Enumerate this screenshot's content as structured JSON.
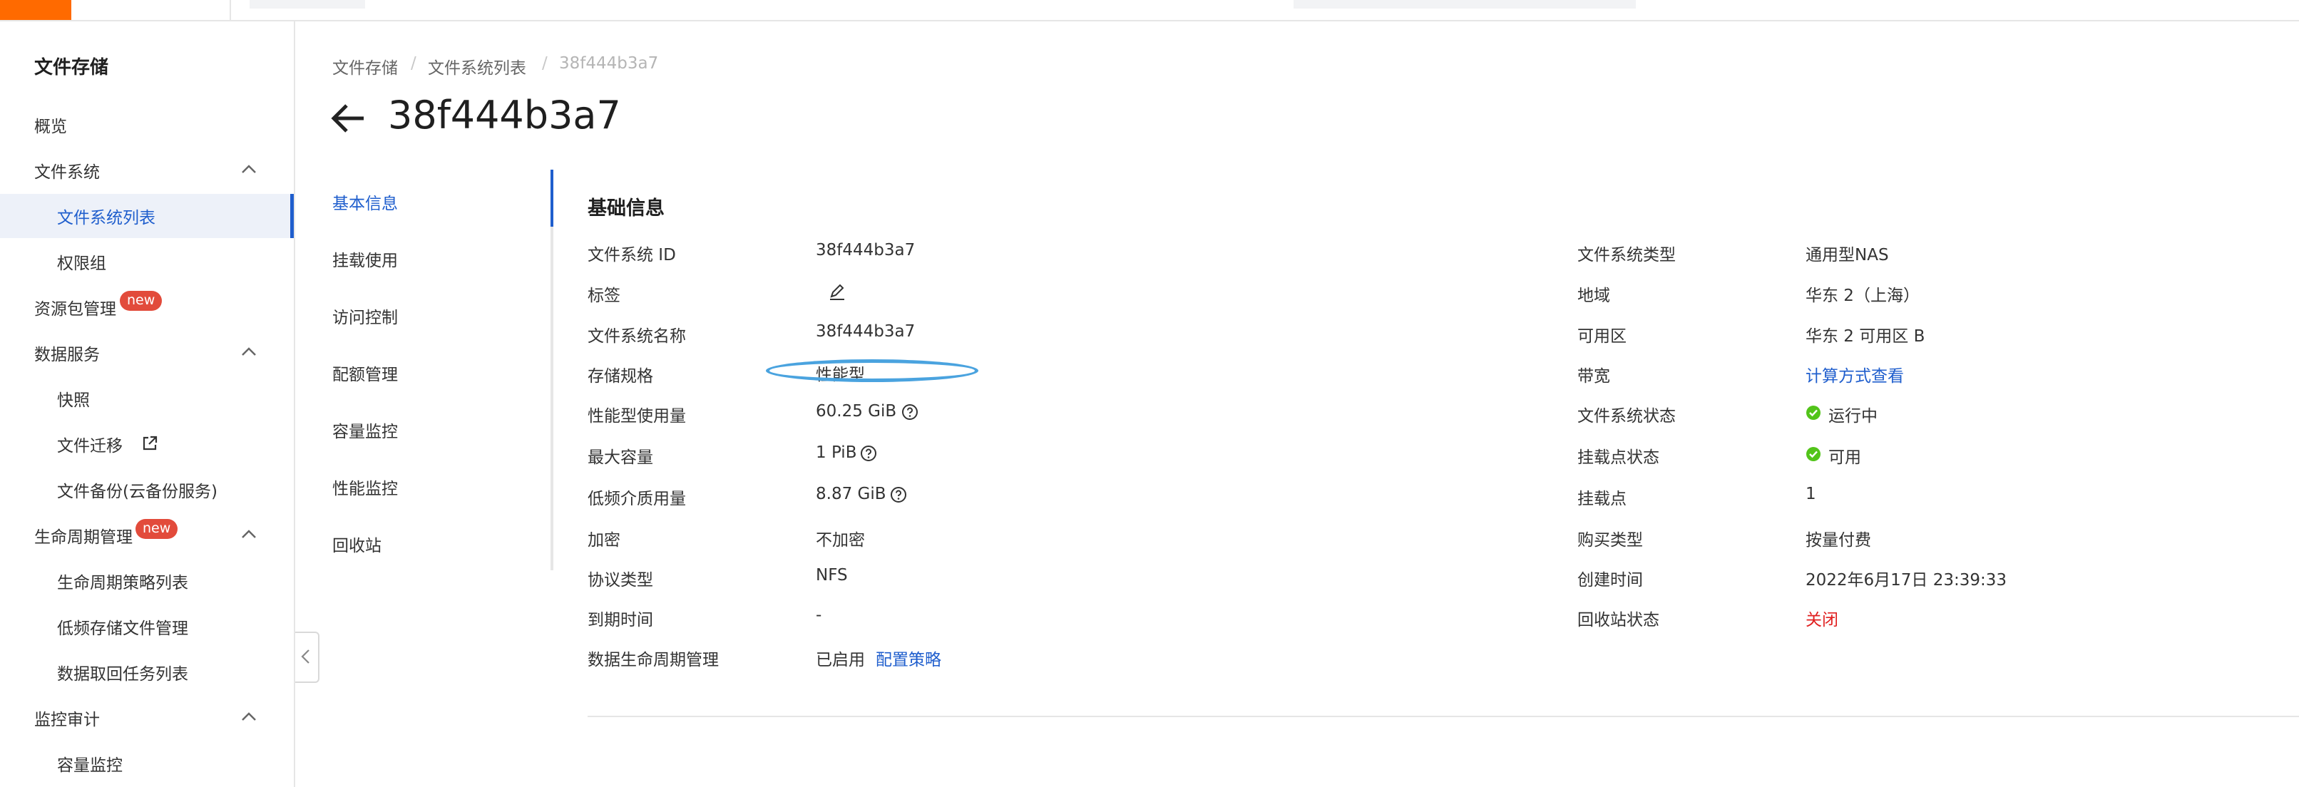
{
  "sidebar": {
    "title": "文件存储",
    "items": {
      "overview": "概览",
      "fs": "文件系统",
      "fs_list": "文件系统列表",
      "perm_group": "权限组",
      "pkg_mgmt": "资源包管理",
      "data_service": "数据服务",
      "snapshot": "快照",
      "migrate": "文件迁移",
      "backup": "文件备份(云备份服务)",
      "lifecycle": "生命周期管理",
      "lc_policy": "生命周期策略列表",
      "lowfreq": "低频存储文件管理",
      "retrieve": "数据取回任务列表",
      "monitor": "监控审计",
      "capacity": "容量监控"
    },
    "badge_new": "new"
  },
  "breadcrumb": {
    "level1": "文件存储",
    "level2": "文件系统列表",
    "current": "38f444b3a7"
  },
  "page_title": "38f444b3a7",
  "tabs": {
    "basic": "基本信息",
    "mount": "挂载使用",
    "access": "访问控制",
    "quota": "配额管理",
    "capmon": "容量监控",
    "perfmon": "性能监控",
    "recycle": "回收站"
  },
  "section_title": "基础信息",
  "left": {
    "fsid_label": "文件系统 ID",
    "fsid_value": "38f444b3a7",
    "tag_label": "标签",
    "name_label": "文件系统名称",
    "name_value": "38f444b3a7",
    "spec_label": "存储规格",
    "spec_value": "性能型",
    "usage_label": "性能型使用量",
    "usage_value": "60.25 GiB",
    "maxcap_label": "最大容量",
    "maxcap_value": "1 PiB",
    "lowfreq_label": "低频介质用量",
    "lowfreq_value": "8.87 GiB",
    "encrypt_label": "加密",
    "encrypt_value": "不加密",
    "proto_label": "协议类型",
    "proto_value": "NFS",
    "expire_label": "到期时间",
    "expire_value": "-",
    "lifecycle_label": "数据生命周期管理",
    "lifecycle_value": "已启用",
    "lifecycle_link": "配置策略"
  },
  "right": {
    "type_label": "文件系统类型",
    "type_value": "通用型NAS",
    "region_label": "地域",
    "region_value": "华东 2（上海）",
    "zone_label": "可用区",
    "zone_value": "华东 2 可用区 B",
    "bw_label": "带宽",
    "bw_link": "计算方式查看",
    "status_label": "文件系统状态",
    "status_value": "运行中",
    "mstatus_label": "挂载点状态",
    "mstatus_value": "可用",
    "mount_label": "挂载点",
    "mount_value": "1",
    "buy_label": "购买类型",
    "buy_value": "按量付费",
    "created_label": "创建时间",
    "created_value": "2022年6月17日 23:39:33",
    "recycle_label": "回收站状态",
    "recycle_value": "关闭"
  },
  "colors": {
    "accent": "#1f5ecd",
    "brand": "#ff6a00",
    "success": "#52c41a",
    "danger": "#e02020",
    "badge": "#e24b3b"
  }
}
